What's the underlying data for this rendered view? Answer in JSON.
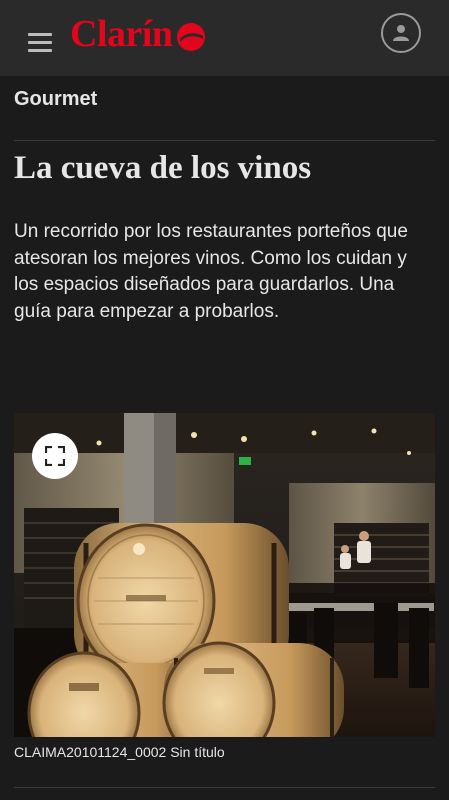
{
  "header": {
    "logo_text": "Clarín",
    "brand_color": "#e2051b",
    "menu_icon": "hamburger-icon",
    "account_icon": "user-icon"
  },
  "article": {
    "section": "Gourmet",
    "title": "La cueva de los vinos",
    "lead": "Un recorrido por los restaurantes porteños que atesoran los mejores vinos. Como los cuidan y los espacios diseñados para guardarlos. Una guía para empezar a probarlos.",
    "image_caption": "CLAIMA20101124_0002 Sin título",
    "expand_icon": "expand-icon"
  }
}
